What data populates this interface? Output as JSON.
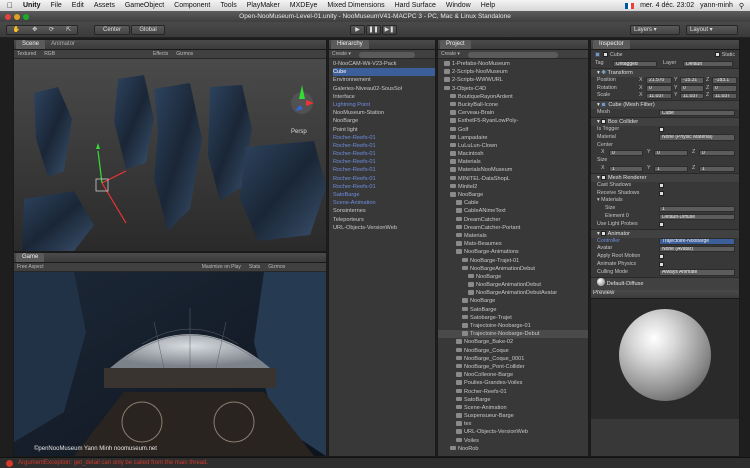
{
  "menubar": {
    "apple": "",
    "app": "Unity",
    "items": [
      "File",
      "Edit",
      "Assets",
      "GameObject",
      "Component",
      "Tools",
      "PlayMaker",
      "MXDEye",
      "Mixed Dimensions",
      "Hard Surface",
      "Window",
      "Help"
    ],
    "time": "mer. 4 déc. 23:02",
    "user": "yann-minh"
  },
  "window_title": "Open-NooMuseum-Level-01.unity - NooMuseumV41-MACPC 3 - PC, Mac & Linux Standalone",
  "toolbar": {
    "center": "Center",
    "global": "Global",
    "layers": "Layers",
    "layout": "Layout"
  },
  "scene": {
    "tab_scene": "Scene",
    "tab_animator": "Animator",
    "textured": "Textured",
    "rgb": "RGB",
    "effects": "Effects",
    "gizmos": "Gizmos",
    "persp": "Persp"
  },
  "game": {
    "tab": "Game",
    "aspect": "Free Aspect",
    "maximize": "Maximize on Play",
    "stats": "Stats",
    "gizmos": "Gizmos",
    "watermark": "©penNooMuseum Yann Minh  noomuseum.net"
  },
  "hierarchy": {
    "tab": "Hierarchy",
    "create": "Create ▾",
    "items": [
      {
        "t": "0-NooCAM-Wii-V23-Pack",
        "s": ""
      },
      {
        "t": "Cube",
        "s": "sel"
      },
      {
        "t": "Environnement",
        "s": ""
      },
      {
        "t": "Galeries-Niveau02-SousSol",
        "s": ""
      },
      {
        "t": "Interface",
        "s": ""
      },
      {
        "t": "Lightning Point",
        "s": "blue"
      },
      {
        "t": "NooMuseum-Station",
        "s": ""
      },
      {
        "t": "NooBarge",
        "s": ""
      },
      {
        "t": "Point light",
        "s": ""
      },
      {
        "t": "Rocher-Reefs-01",
        "s": "blue"
      },
      {
        "t": "Rocher-Reefs-01",
        "s": "blue"
      },
      {
        "t": "Rocher-Reefs-01",
        "s": "blue"
      },
      {
        "t": "Rocher-Reefs-01",
        "s": "blue"
      },
      {
        "t": "Rocher-Reefs-01",
        "s": "blue"
      },
      {
        "t": "Rocher-Reefs-01",
        "s": "blue"
      },
      {
        "t": "Rocher-Reefs-01",
        "s": "blue"
      },
      {
        "t": "SatoBarge",
        "s": "blue"
      },
      {
        "t": "Scene-Animation",
        "s": "blue"
      },
      {
        "t": "Sonsinternes",
        "s": ""
      },
      {
        "t": "Teleporteurs",
        "s": ""
      },
      {
        "t": "URL-Objects-VersionWeb",
        "s": ""
      }
    ]
  },
  "project": {
    "tab": "Project",
    "create": "Create ▾",
    "items": [
      {
        "t": "1-Prefabs-NooMuseum",
        "d": 1
      },
      {
        "t": "2-Scripts-NooMuseum",
        "d": 1
      },
      {
        "t": "2-Scripts-WWWURL",
        "d": 1
      },
      {
        "t": "3-Objets-C4D",
        "d": 1
      },
      {
        "t": "BoutiqueRayonArdent",
        "d": 2
      },
      {
        "t": "BuckyBall-Icone",
        "d": 2
      },
      {
        "t": "Cerveau-Brain",
        "d": 2
      },
      {
        "t": "EsthetF5-RyanLowPoly-",
        "d": 2
      },
      {
        "t": "Golf",
        "d": 2
      },
      {
        "t": "Lampadaire",
        "d": 2
      },
      {
        "t": "LuLuLun-Clown",
        "d": 2
      },
      {
        "t": "Macintosh",
        "d": 2
      },
      {
        "t": "Materials",
        "d": 2
      },
      {
        "t": "MaterialsNooMuseum",
        "d": 2
      },
      {
        "t": "MINITEL-DataShopL",
        "d": 2
      },
      {
        "t": "Minitel2",
        "d": 2
      },
      {
        "t": "NooBarge",
        "d": 2
      },
      {
        "t": "Cable",
        "d": 3
      },
      {
        "t": "CableANimeText",
        "d": 3
      },
      {
        "t": "DreamCatcher",
        "d": 3
      },
      {
        "t": "DreamCatcher-Portant",
        "d": 3
      },
      {
        "t": "Materials",
        "d": 3
      },
      {
        "t": "Mats-Beaumes",
        "d": 3
      },
      {
        "t": "NooBarge-Animations",
        "d": 3
      },
      {
        "t": "NooBarge-Trajet-01",
        "d": 4
      },
      {
        "t": "NooBargeAnimationDebut",
        "d": 4
      },
      {
        "t": "NooBarge",
        "d": 5
      },
      {
        "t": "NooBargeAnimationDebut",
        "d": 5
      },
      {
        "t": "NooBargeAnimationDebutAvatar",
        "d": 5
      },
      {
        "t": "NooBarge",
        "d": 4
      },
      {
        "t": "SatoBarge",
        "d": 4
      },
      {
        "t": "Satobarge-Trajet",
        "d": 4
      },
      {
        "t": "Trajectoire-Noobarge-01",
        "d": 4
      },
      {
        "t": "Trajectoire-Noobarge-Debut",
        "d": 4
      },
      {
        "t": "NooBarge_Bake-02",
        "d": 3
      },
      {
        "t": "NooBarge_Coque",
        "d": 3
      },
      {
        "t": "NooBarge_Coque_0001",
        "d": 3
      },
      {
        "t": "NooBarge_Pont-Collider",
        "d": 3
      },
      {
        "t": "NooColleone-Barge",
        "d": 3
      },
      {
        "t": "Poulies-Grandes-Voiles",
        "d": 3
      },
      {
        "t": "Rocher-Reefs-01",
        "d": 3
      },
      {
        "t": "SatoBarge",
        "d": 3
      },
      {
        "t": "Scene-Animation",
        "d": 3
      },
      {
        "t": "Suspensueur-Barge",
        "d": 3
      },
      {
        "t": "tex",
        "d": 3
      },
      {
        "t": "URL-Objects-VersionWeb",
        "d": 3
      },
      {
        "t": "Voiles",
        "d": 3
      },
      {
        "t": "NooRob",
        "d": 2
      }
    ]
  },
  "inspector": {
    "tab": "Inspector",
    "object_name": "Cube",
    "static": "Static",
    "tag_label": "Tag",
    "tag": "Untagged",
    "layer_label": "Layer",
    "layer": "Default",
    "transform": {
      "title": "Transform",
      "position_label": "Position",
      "position": [
        "21.570",
        "-15.31",
        "-183.1"
      ],
      "rotation_label": "Rotation",
      "rotation": [
        "0",
        "0",
        "0"
      ],
      "scale_label": "Scale",
      "scale": [
        "11.037",
        "11.037",
        "11.037"
      ]
    },
    "meshfilter": {
      "title": "Cube (Mesh Filter)",
      "mesh_label": "Mesh",
      "mesh": "Cube"
    },
    "boxcollider": {
      "title": "Box Collider",
      "trigger": "Is Trigger",
      "material_label": "Material",
      "material": "None (Physic Material)",
      "center": "Center",
      "center_vals": [
        "0",
        "0",
        "0"
      ],
      "size": "Size",
      "size_vals": [
        "1",
        "1",
        "1"
      ]
    },
    "meshrenderer": {
      "title": "Mesh Renderer",
      "cast": "Cast Shadows",
      "receive": "Receive Shadows",
      "materials": "Materials",
      "msize": "Size",
      "msize_val": "1",
      "element0": "Element 0",
      "element0_val": "Default-Diffuse",
      "lightprobes": "Use Light Probes"
    },
    "animator": {
      "title": "Animator",
      "controller_label": "Controller",
      "controller": "Trajectoire-Noobarge",
      "avatar_label": "Avatar",
      "avatar": "None (Avatar)",
      "apply": "Apply Root Motion",
      "physics": "Animate Physics",
      "culling_label": "Culling Mode",
      "culling": "Always Animate"
    },
    "material": "Default-Diffuse",
    "preview": "Preview"
  },
  "status": "ArgumentException: get_detail can only be called from the main thread.",
  "colors": {
    "accent": "#3d5f99",
    "link": "#6f8fe0",
    "error": "#d23a2a"
  }
}
